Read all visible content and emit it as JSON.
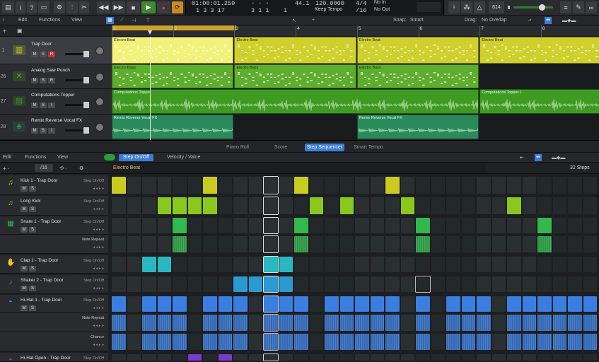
{
  "transport": {
    "time": "01:00:01.259",
    "time_sub": "1 3 3 17",
    "bars": "3 1 1",
    "bars_sub": "1",
    "tempo": "120.0000",
    "tempo_mode": "Keep Tempo",
    "signature": "4/4",
    "division": "/16",
    "sig_top": "44.1",
    "midi_in": "No In",
    "midi_out": "No Out",
    "cpu": "614"
  },
  "arrange_toolbar": {
    "edit": "Edit",
    "functions": "Functions",
    "view": "View",
    "snap_label": "Snap:",
    "snap_value": "Smart",
    "drag_label": "Drag:",
    "drag_value": "No Overlap"
  },
  "ruler": {
    "bars": [
      "1",
      "2",
      "3",
      "4",
      "5",
      "6",
      "7",
      "8"
    ]
  },
  "tracks": [
    {
      "num": "1",
      "name": "Trap Door",
      "mute": "M",
      "solo": "S",
      "rec": "R",
      "color": "#c8cc2a"
    },
    {
      "num": "26",
      "name": "Analog Saw Punch",
      "mute": "M",
      "solo": "S",
      "rec": "R",
      "color": "#58a82a"
    },
    {
      "num": "27",
      "name": "Computations Topper",
      "mute": "M",
      "solo": "S",
      "rec": "I",
      "color": "#3f9a22"
    },
    {
      "num": "28",
      "name": "Remix Reverse Vocal FX",
      "mute": "M",
      "solo": "S",
      "rec": "I",
      "color": "#2a8a5a"
    }
  ],
  "regions": {
    "electro_beat": "Electro Beat",
    "electro_bass": "Electro Bass",
    "topper": "Computations Topper",
    "topper_loop": "Computations Topper.1",
    "topper_short": "Computat",
    "remix": "Remix Reverse Vocal FX"
  },
  "editor_tabs": [
    "Piano Roll",
    "Score",
    "Step Sequencer",
    "Smart Tempo"
  ],
  "editor_toolbar": {
    "edit": "Edit",
    "functions": "Functions",
    "view": "View",
    "step_mode": "Step On/Off",
    "velocity": "Velocity / Value",
    "division": "/16",
    "pattern_name": "Electro Beat",
    "steps": "32 Steps"
  },
  "rows": [
    {
      "name": "Kick 1 - Trap Door",
      "mode": "Step On/Off",
      "mute": "M",
      "solo": "S"
    },
    {
      "name": "Long Kick",
      "mode": "Step On/Off",
      "mute": "M",
      "solo": "S"
    },
    {
      "name": "Snare 1 - Trap Door",
      "mode": "Step On/Off",
      "mute": "M",
      "solo": "S",
      "sub": "Note Repeat"
    },
    {
      "name": "Clap 1 - Trap Door",
      "mode": "Step On/Off",
      "mute": "M",
      "solo": "S"
    },
    {
      "name": "Shaker 2 - Trap Door",
      "mode": "Step On/Off",
      "mute": "M",
      "solo": "S"
    },
    {
      "name": "Hi-Hat 1 - Trap Door",
      "mode": "Step On/Off",
      "mute": "M",
      "solo": "S",
      "sub": "Note Repeat",
      "sub2": "Chance"
    },
    {
      "name": "Hi-Hat Open - Trap Door",
      "mode": "Step On/Off",
      "mute": "M",
      "solo": "S"
    }
  ],
  "colors": {
    "kick": "#c9cc1e",
    "longkick": "#8ac81e",
    "snare": "#32b84c",
    "clap": "#2ab8c0",
    "shaker": "#2a9ad0",
    "hihat": "#3a7ee0",
    "open": "#7a3ad0"
  }
}
